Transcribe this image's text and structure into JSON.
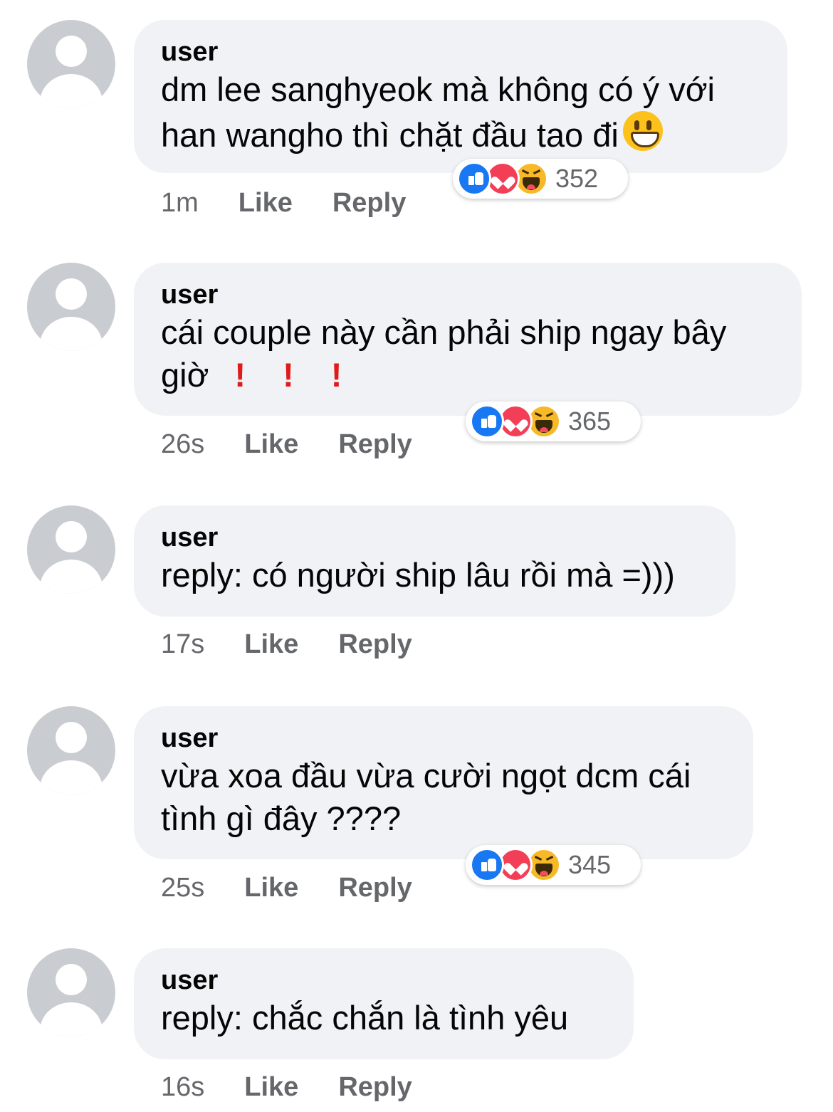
{
  "comments": [
    {
      "username": "user",
      "lines": [
        "dm lee sanghyeok mà không có ý với",
        "han wangho thì chặt đầu tao đi"
      ],
      "trailing_emoji": "grinning-face",
      "time": "1m",
      "like_label": "Like",
      "reply_label": "Reply",
      "reactions": [
        "like",
        "love",
        "haha"
      ],
      "reaction_count": "352"
    },
    {
      "username": "user",
      "lines": [
        "cái couple này cần phải ship ngay bây",
        "giờ"
      ],
      "trailing_marks": [
        "!",
        "!",
        "!"
      ],
      "time": "26s",
      "like_label": "Like",
      "reply_label": "Reply",
      "reactions": [
        "like",
        "love",
        "haha"
      ],
      "reaction_count": "365"
    },
    {
      "username": "user",
      "lines": [
        "reply: có người ship lâu rồi mà =)))"
      ],
      "time": "17s",
      "like_label": "Like",
      "reply_label": "Reply"
    },
    {
      "username": "user",
      "lines": [
        "vừa xoa đầu vừa cười ngọt dcm cái",
        "tình gì đây ????"
      ],
      "time": "25s",
      "like_label": "Like",
      "reply_label": "Reply",
      "reactions": [
        "like",
        "love",
        "haha"
      ],
      "reaction_count": "345"
    },
    {
      "username": "user",
      "lines": [
        "reply: chắc chắn là tình yêu"
      ],
      "time": "16s",
      "like_label": "Like",
      "reply_label": "Reply"
    }
  ],
  "colors": {
    "bubble": "#f0f2f5",
    "meta_text": "#65676b",
    "like_reaction": "#1877f2",
    "love_reaction": "#f33e58",
    "haha_reaction": "#f7b928",
    "exclamation": "#e01a1a"
  }
}
